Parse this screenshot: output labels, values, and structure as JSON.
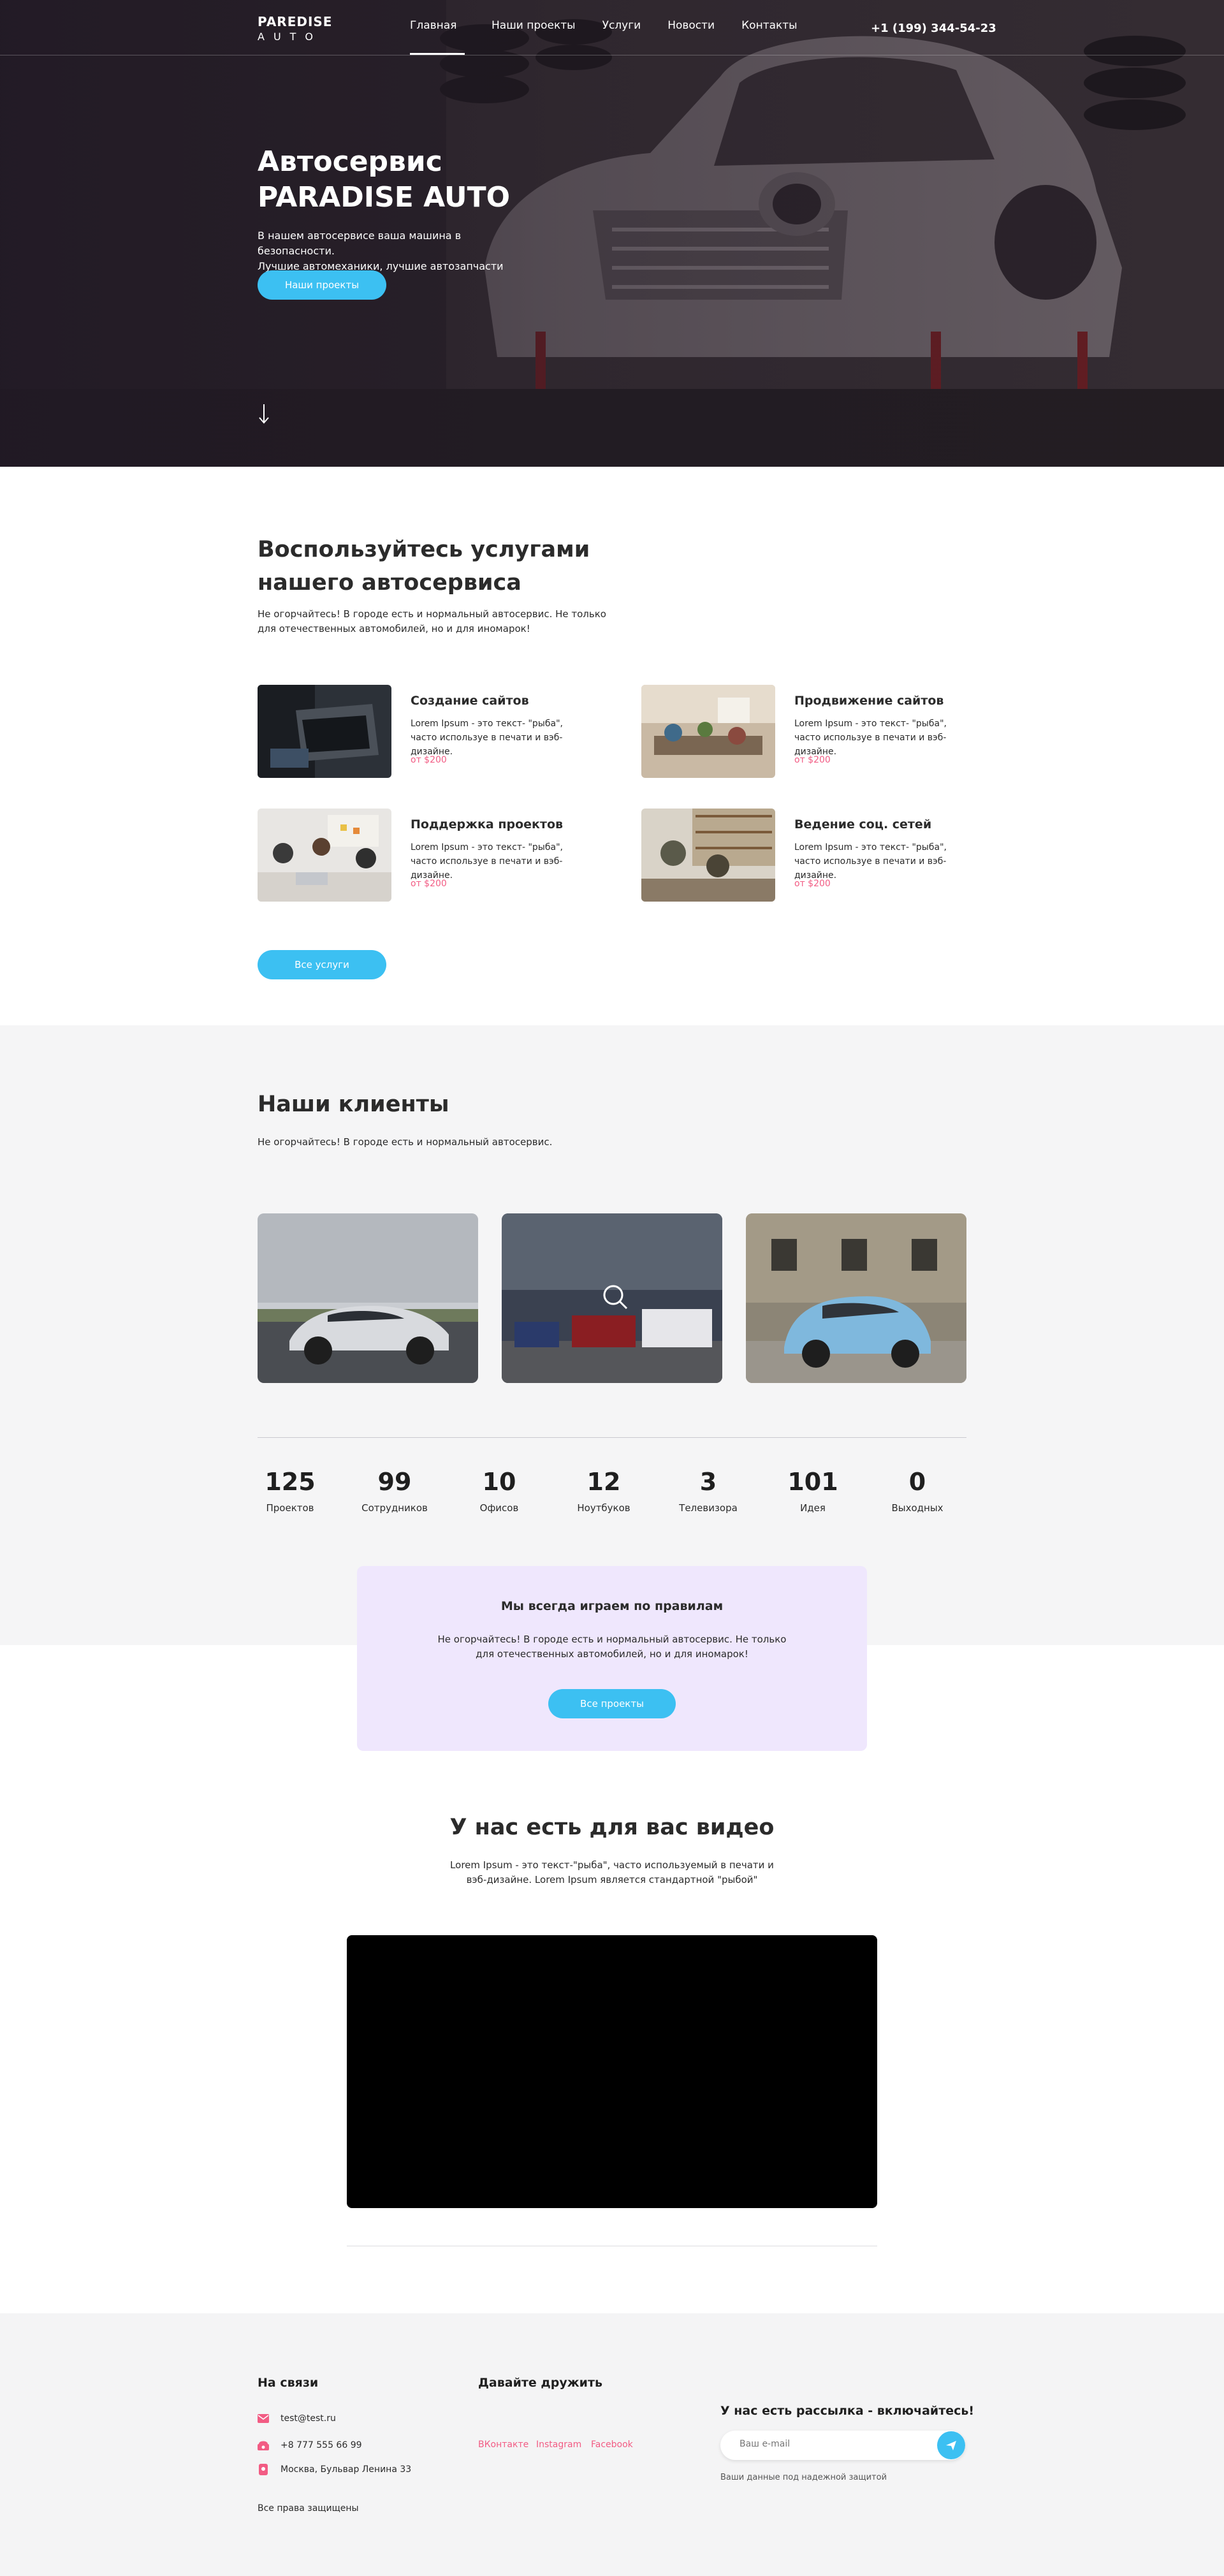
{
  "header": {
    "logo_line1": "PAREDISE",
    "logo_line2": "AUTO",
    "nav": [
      "Главная",
      "Наши проекты",
      "Услуги",
      "Новости",
      "Контакты"
    ],
    "phone": "+1 (199) 344-54-23"
  },
  "hero": {
    "title_line1": "Автосервис",
    "title_line2": "PARADISE AUTO",
    "subtitle_line1": "В нашем автосервисе ваша машина в безопасности.",
    "subtitle_line2": "Лучшие автомеханики, лучшие автозапчасти",
    "button": "Наши проекты"
  },
  "services": {
    "title": "Воспользуйтесь услугами нашего автосервиса",
    "subtitle": "Не огорчайтесь! В городе есть и нормальный автосервис. Не только для отечественных автомобилей, но и для иномарок!",
    "items": [
      {
        "name": "Создание сайтов",
        "desc": "Lorem Ipsum - это текст- \"рыба\", часто используе в печати и вэб-дизайне.",
        "price": "от $200"
      },
      {
        "name": "Продвижение сайтов",
        "desc": "Lorem Ipsum - это текст- \"рыба\", часто используе в печати и вэб-дизайне.",
        "price": "от $200"
      },
      {
        "name": "Поддержка проектов",
        "desc": "Lorem Ipsum - это текст- \"рыба\", часто используе в печати и вэб-дизайне.",
        "price": "от $200"
      },
      {
        "name": "Ведение соц. сетей",
        "desc": "Lorem Ipsum - это текст- \"рыба\", часто используе в печати и вэб-дизайне.",
        "price": "от $200"
      }
    ],
    "button": "Все услуги"
  },
  "clients": {
    "title": "Наши клиенты",
    "subtitle": "Не огорчайтесь! В городе есть и нормальный автосервис.",
    "stats": [
      {
        "num": "125",
        "label": "Проектов"
      },
      {
        "num": "99",
        "label": "Сотрудников"
      },
      {
        "num": "10",
        "label": "Офисов"
      },
      {
        "num": "12",
        "label": "Ноутбуков"
      },
      {
        "num": "3",
        "label": "Телевизора"
      },
      {
        "num": "101",
        "label": "Идея"
      },
      {
        "num": "0",
        "label": "Выходных"
      }
    ]
  },
  "rules": {
    "title": "Мы всегда играем по правилам",
    "desc": "Не огорчайтесь! В городе есть и нормальный автосервис. Не только для отечественных автомобилей, но и для иномарок!",
    "button": "Все проекты"
  },
  "video": {
    "title": "У нас есть для вас видео",
    "desc": "Lorem Ipsum - это текст-\"рыба\", часто используемый в печати и вэб-дизайне. Lorem Ipsum является стандартной \"рыбой\""
  },
  "footer": {
    "contacts_title": "На связи",
    "email": "test@test.ru",
    "phone": "+8 777 555 66 99",
    "address": "Москва, Бульвар Ленина 33",
    "rights": "Все права защищены",
    "friends_title": "Давайте дружить",
    "socials": [
      "ВКонтакте",
      "Instagram",
      "Facebook"
    ],
    "newsletter_title": "У нас есть рассылка - включайтесь!",
    "email_placeholder": "Ваш e-mail",
    "note": "Ваши данные под надежной защитой"
  },
  "colors": {
    "accent": "#3cc0f2",
    "price": "#f25c84",
    "rules_bg": "#efe7fd",
    "section_bg": "#f5f5f6"
  }
}
